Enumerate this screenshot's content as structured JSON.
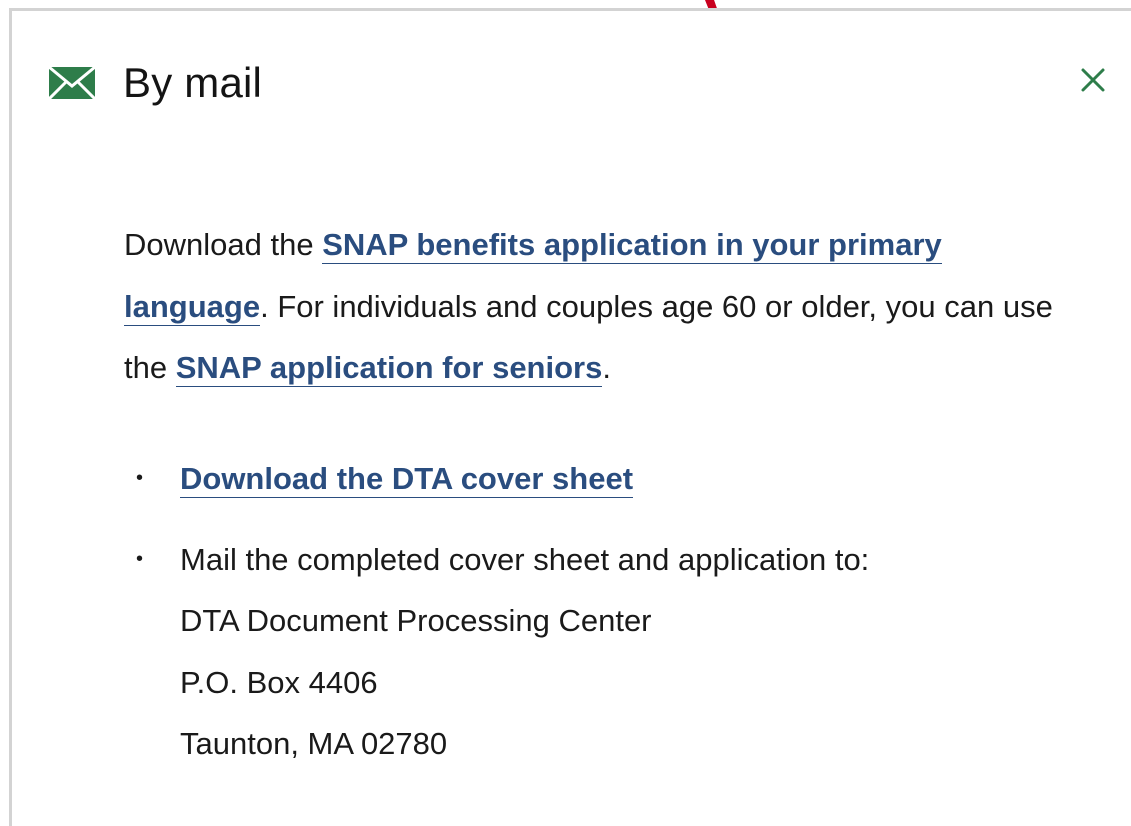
{
  "header": {
    "icon": "envelope-icon",
    "title": "By mail",
    "close_icon": "close-icon"
  },
  "intro": {
    "text1": "Download the ",
    "link1": "SNAP benefits application in your primary language",
    "text2": ". For individuals and couples age 60 or older, you can use the ",
    "link2": "SNAP application for seniors",
    "text3": "."
  },
  "list": {
    "bullet": "•",
    "item1_link": "Download the DTA cover sheet",
    "item2_text": "Mail the completed cover sheet and application to:",
    "address": {
      "line1": "DTA Document Processing Center",
      "line2": "P.O. Box 4406",
      "line3": "Taunton, MA 02780"
    }
  },
  "colors": {
    "link": "#2a4d7f",
    "icon_green": "#2e7d4a",
    "arrow_red": "#c8001e"
  }
}
